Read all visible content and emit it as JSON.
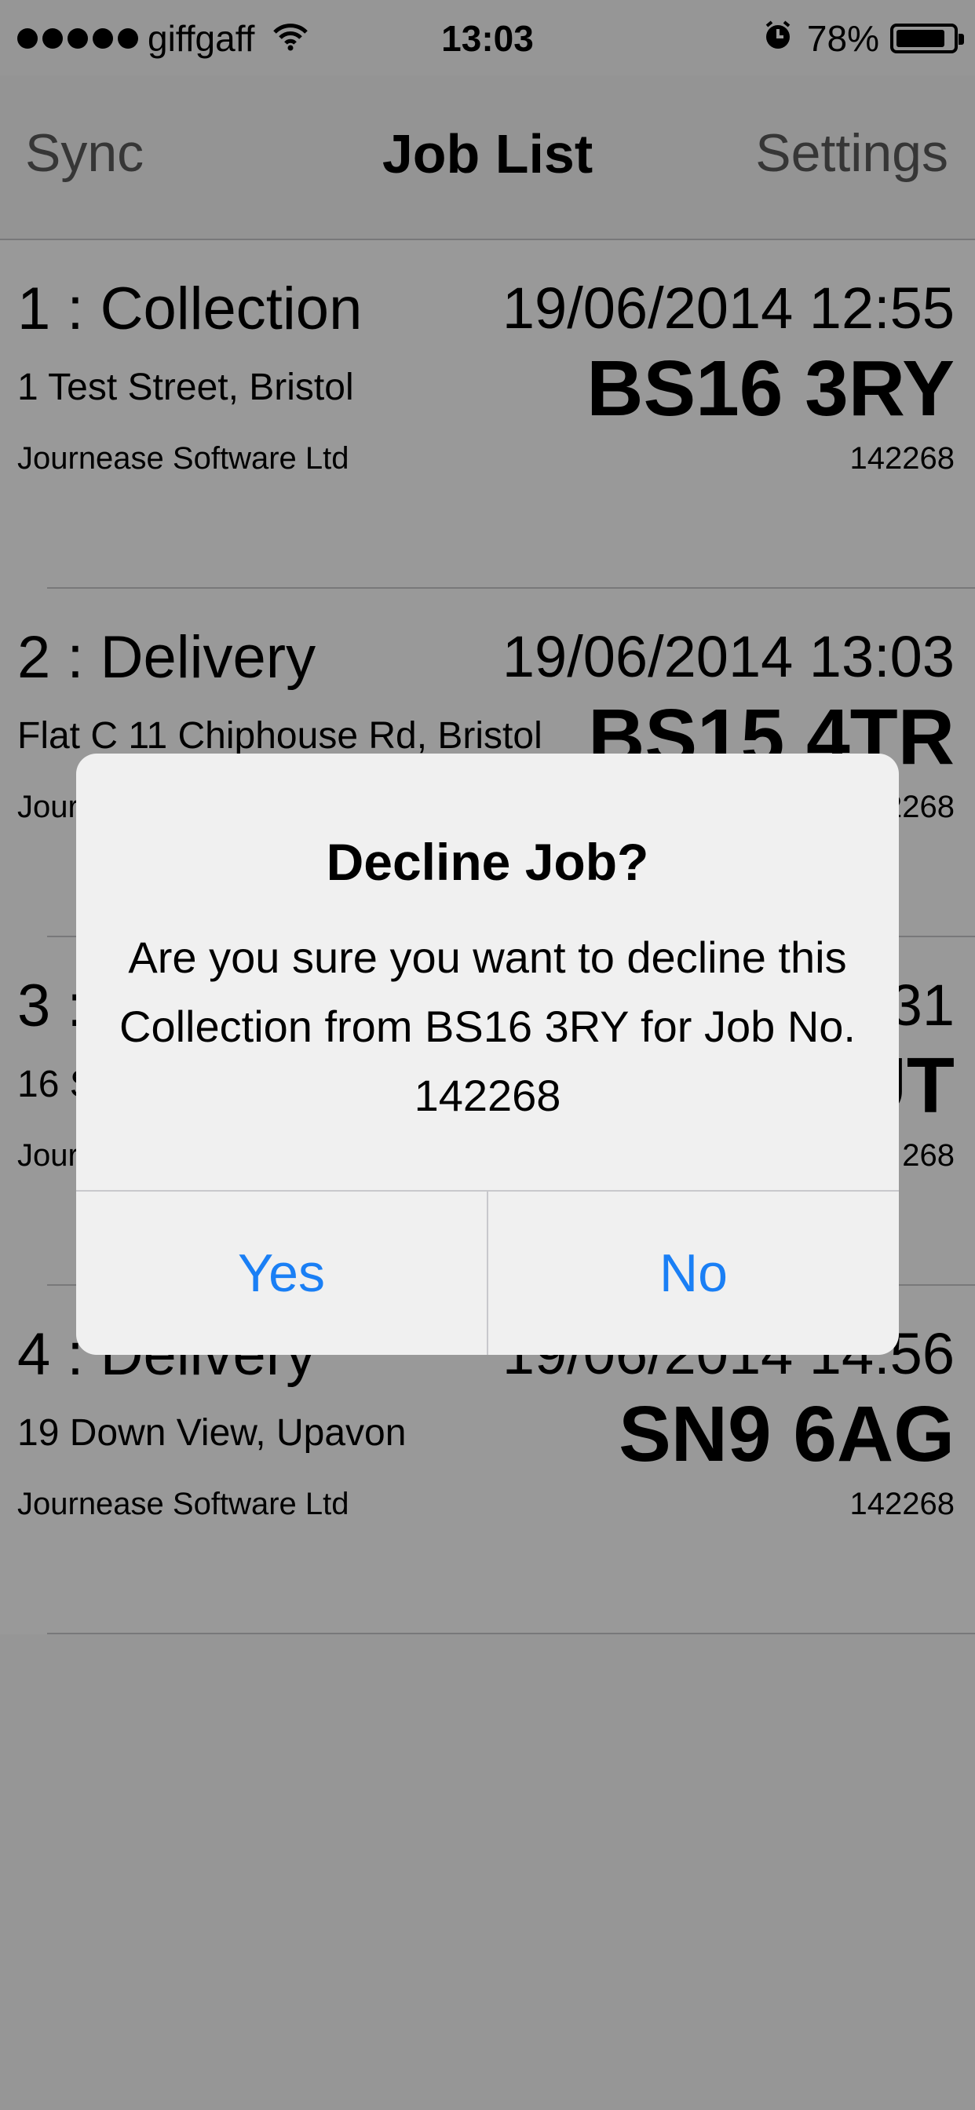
{
  "status_bar": {
    "carrier": "giffgaff",
    "time": "13:03",
    "battery": "78%"
  },
  "nav": {
    "left_label": "Sync",
    "title": "Job List",
    "right_label": "Settings"
  },
  "jobs": [
    {
      "title": "1 :   Collection",
      "datetime": "19/06/2014 12:55",
      "address": "1 Test Street, Bristol",
      "postcode": "BS16 3RY",
      "company": "Journease Software Ltd",
      "job_no": "142268"
    },
    {
      "title": "2 :   Delivery",
      "datetime": "19/06/2014 13:03",
      "address": "Flat C 11 Chiphouse Rd, Bristol",
      "postcode": "BS15 4TR",
      "company": "Journease Software Ltd",
      "job_no": "142268"
    },
    {
      "title": "3 :",
      "datetime": "31",
      "address": "16 S",
      "postcode": "UT",
      "company": "Journ",
      "job_no": "268"
    },
    {
      "title": "4 :   Delivery",
      "datetime": "19/06/2014 14:56",
      "address": "19 Down View, Upavon",
      "postcode": "SN9 6AG",
      "company": "Journease Software Ltd",
      "job_no": "142268"
    }
  ],
  "dialog": {
    "title": "Decline Job?",
    "message": "Are you sure you want to decline this Collection from BS16 3RY for Job No. 142268",
    "yes_label": "Yes",
    "no_label": "No"
  },
  "colors": {
    "accent": "#1a7ff5",
    "overlay": "#000000"
  }
}
